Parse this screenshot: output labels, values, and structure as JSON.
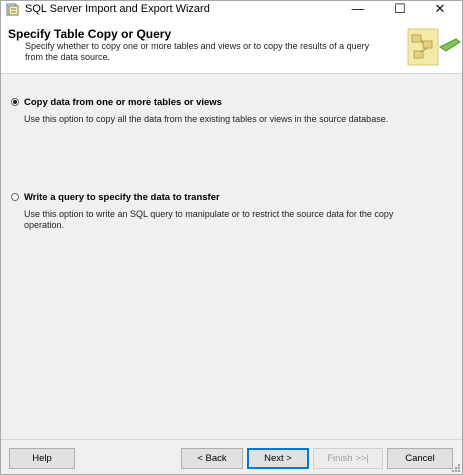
{
  "window": {
    "title": "SQL Server Import and Export Wizard",
    "minimize_glyph": "—",
    "maximize_glyph": "☐",
    "close_glyph": "✕"
  },
  "header": {
    "title": "Specify Table Copy or Query",
    "subtitle": "Specify whether to copy one or more tables and views or to copy the results of a query from the data source."
  },
  "options": [
    {
      "label": "Copy data from one or more tables or views",
      "description": "Use this option to copy all the data from the existing tables or views in the source database.",
      "selected": true
    },
    {
      "label": "Write a query to specify the data to transfer",
      "description": "Use this option to write an SQL query to manipulate or to restrict the source data for the copy operation.",
      "selected": false
    }
  ],
  "footer": {
    "help": "Help",
    "back": "< Back",
    "next": "Next >",
    "finish": "Finish >>|",
    "cancel": "Cancel"
  },
  "colors": {
    "accent": "#0078d7",
    "background": "#f0f0f0",
    "header_background": "#ffffff"
  }
}
